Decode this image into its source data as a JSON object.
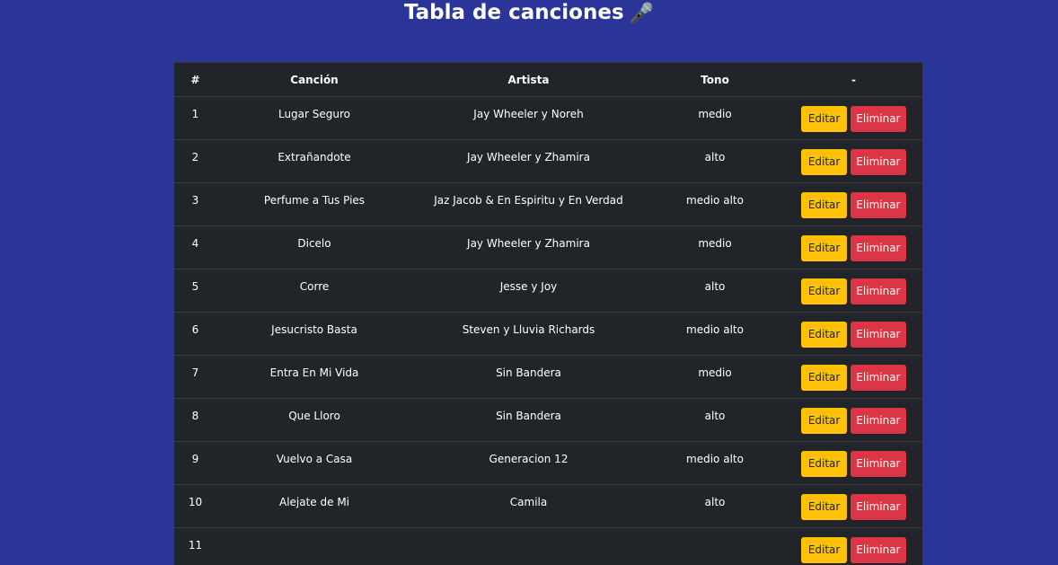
{
  "header": {
    "title": "Tabla de canciones",
    "icon": "microphone-icon"
  },
  "table": {
    "columns": [
      "#",
      "Canción",
      "Artista",
      "Tono",
      "-"
    ],
    "edit_label": "Editar",
    "delete_label": "Eliminar",
    "rows": [
      {
        "num": "1",
        "song": "Lugar Seguro",
        "artist": "Jay Wheeler y Noreh",
        "tone": "medio"
      },
      {
        "num": "2",
        "song": "Extrañandote",
        "artist": "Jay Wheeler y Zhamira",
        "tone": "alto"
      },
      {
        "num": "3",
        "song": "Perfume a Tus Pies",
        "artist": "Jaz Jacob & En Espiritu y En Verdad",
        "tone": "medio alto"
      },
      {
        "num": "4",
        "song": "Dicelo",
        "artist": "Jay Wheeler y Zhamira",
        "tone": "medio"
      },
      {
        "num": "5",
        "song": "Corre",
        "artist": "Jesse y Joy",
        "tone": "alto"
      },
      {
        "num": "6",
        "song": "Jesucristo Basta",
        "artist": "Steven y Lluvia Richards",
        "tone": "medio alto"
      },
      {
        "num": "7",
        "song": "Entra En Mi Vida",
        "artist": "Sin Bandera",
        "tone": "medio"
      },
      {
        "num": "8",
        "song": "Que Lloro",
        "artist": "Sin Bandera",
        "tone": "alto"
      },
      {
        "num": "9",
        "song": "Vuelvo a Casa",
        "artist": "Generacion 12",
        "tone": "medio alto"
      },
      {
        "num": "10",
        "song": "Alejate de Mi",
        "artist": "Camila",
        "tone": "alto"
      },
      {
        "num": "11",
        "song": "",
        "artist": "",
        "tone": ""
      }
    ]
  },
  "colors": {
    "background": "#2b3499",
    "table_bg": "#212529",
    "edit_button": "#ffc107",
    "delete_button": "#dc3545"
  }
}
